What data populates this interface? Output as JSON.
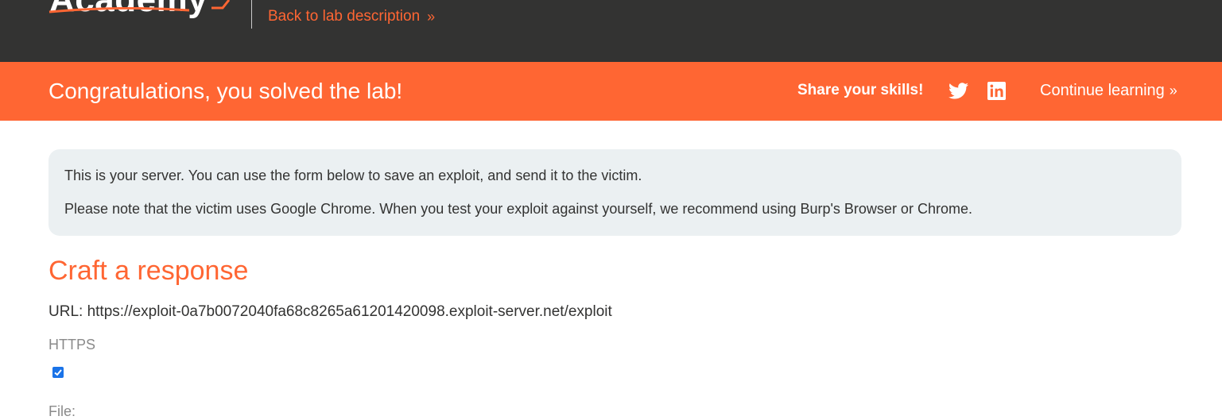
{
  "header": {
    "logo_text": "Academy",
    "back_link_label": "Back to lab description",
    "back_link_chevron": "»"
  },
  "banner": {
    "title": "Congratulations, you solved the lab!",
    "share_label": "Share your skills!",
    "share_icons": [
      "twitter-icon",
      "linkedin-icon"
    ],
    "continue_label": "Continue learning",
    "continue_chevron": "»"
  },
  "info": {
    "line1": "This is your server. You can use the form below to save an exploit, and send it to the victim.",
    "line2": "Please note that the victim uses Google Chrome. When you test your exploit against yourself, we recommend using Burp's Browser or Chrome."
  },
  "form": {
    "heading": "Craft a response",
    "url_text": "URL: https://exploit-0a7b0072040fa68c8265a61201420098.exploit-server.net/exploit",
    "https_label": "HTTPS",
    "https_checked": true,
    "file_label": "File:"
  },
  "colors": {
    "accent": "#ff6633",
    "topbar": "#333332",
    "info_bg": "#ebf0f2",
    "checkbox": "#1a73e8"
  }
}
